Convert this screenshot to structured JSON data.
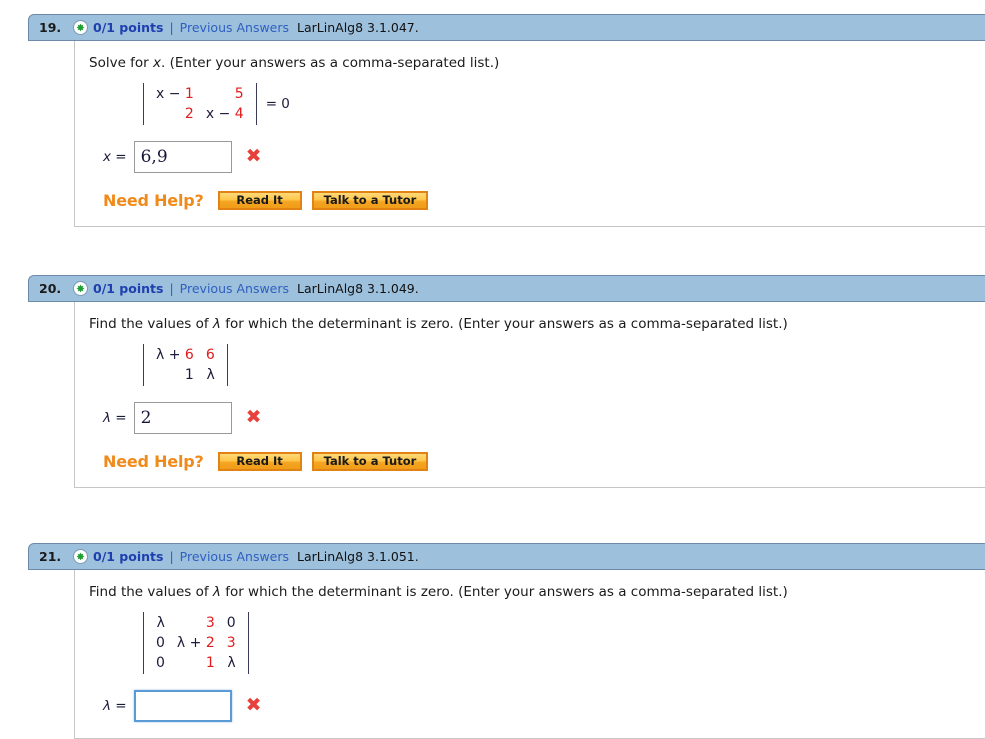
{
  "problems": [
    {
      "number": "19.",
      "points": "0/1 points",
      "separator": "|",
      "previous_answers": "Previous Answers",
      "code": "LarLinAlg8 3.1.047.",
      "question_prefix": "Solve for ",
      "question_var": "x",
      "question_suffix": ". (Enter your answers as a comma-separated list.)",
      "matrix": {
        "rows": 2,
        "cols": 2,
        "cells": [
          [
            {
              "t": "x − ",
              "c": "dark"
            },
            {
              "t": "1",
              "c": "red"
            }
          ],
          [
            {
              "t": "5",
              "c": "red"
            }
          ],
          [
            {
              "t": "2",
              "c": "red"
            }
          ],
          [
            {
              "t": "x − ",
              "c": "dark"
            },
            {
              "t": "4",
              "c": "red"
            }
          ]
        ],
        "trailer": "= 0"
      },
      "answer_label": "x =",
      "answer_value": "6,9",
      "answer_focused": false,
      "mark": "✖",
      "need_help_label": "Need Help?",
      "read_it_label": "Read It",
      "tutor_label": "Talk to a Tutor",
      "has_help": true
    },
    {
      "number": "20.",
      "points": "0/1 points",
      "separator": "|",
      "previous_answers": "Previous Answers",
      "code": "LarLinAlg8 3.1.049.",
      "question_prefix": "Find the values of ",
      "question_var": "λ",
      "question_suffix": " for which the determinant is zero. (Enter your answers as a comma-separated list.)",
      "matrix": {
        "rows": 2,
        "cols": 2,
        "cells": [
          [
            {
              "t": "λ + ",
              "c": "dark"
            },
            {
              "t": "6",
              "c": "red"
            }
          ],
          [
            {
              "t": "6",
              "c": "red"
            }
          ],
          [
            {
              "t": "1",
              "c": "dark"
            }
          ],
          [
            {
              "t": "λ",
              "c": "dark"
            }
          ]
        ],
        "trailer": ""
      },
      "answer_label": "λ =",
      "answer_value": "2",
      "answer_focused": false,
      "mark": "✖",
      "need_help_label": "Need Help?",
      "read_it_label": "Read It",
      "tutor_label": "Talk to a Tutor",
      "has_help": true
    },
    {
      "number": "21.",
      "points": "0/1 points",
      "separator": "|",
      "previous_answers": "Previous Answers",
      "code": "LarLinAlg8 3.1.051.",
      "question_prefix": "Find the values of ",
      "question_var": "λ",
      "question_suffix": " for which the determinant is zero. (Enter your answers as a comma-separated list.)",
      "matrix": {
        "rows": 3,
        "cols": 3,
        "cells": [
          [
            {
              "t": "λ",
              "c": "dark"
            }
          ],
          [
            {
              "t": "3",
              "c": "red"
            }
          ],
          [
            {
              "t": "0",
              "c": "dark"
            }
          ],
          [
            {
              "t": "0",
              "c": "dark"
            }
          ],
          [
            {
              "t": "λ + ",
              "c": "dark"
            },
            {
              "t": "2",
              "c": "red"
            }
          ],
          [
            {
              "t": "3",
              "c": "red"
            }
          ],
          [
            {
              "t": "0",
              "c": "dark"
            }
          ],
          [
            {
              "t": "1",
              "c": "red"
            }
          ],
          [
            {
              "t": "λ",
              "c": "dark"
            }
          ]
        ],
        "trailer": ""
      },
      "answer_label": "λ =",
      "answer_value": "",
      "answer_focused": true,
      "mark": "✖",
      "need_help_label": "Need Help?",
      "read_it_label": "Read It",
      "tutor_label": "Talk to a Tutor",
      "has_help": false
    }
  ],
  "colors": {
    "header_bg": "#9dc0dd",
    "points_blue": "#1e3fae",
    "link_blue": "#2f5fbf",
    "matrix_red": "#e01b1b",
    "mark_red": "#e8413c",
    "help_orange": "#f08a1b"
  },
  "icons": {
    "plus_badge": "plus-circle-icon",
    "wrong_mark": "x-mark-icon"
  }
}
